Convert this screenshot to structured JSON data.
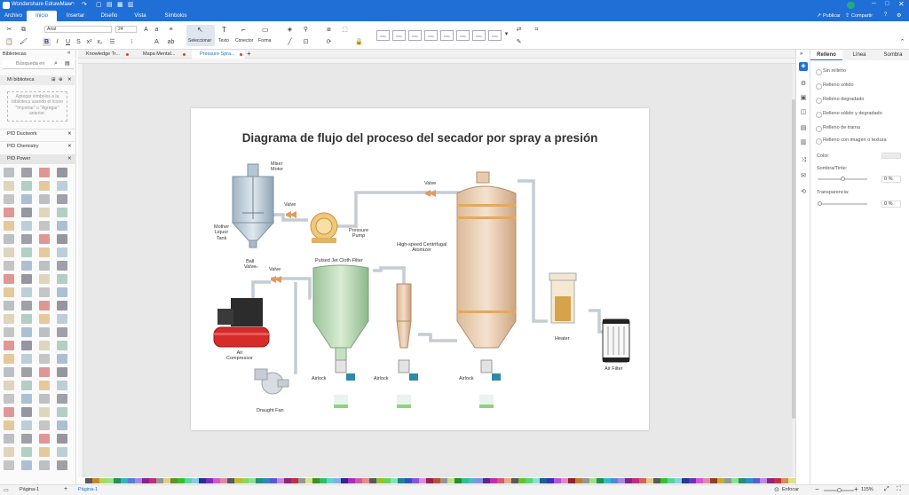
{
  "titlebar": {
    "app_name": "Wondershare EdrawMax",
    "publish": "Publicar",
    "share": "Compartir"
  },
  "menu": {
    "tabs": [
      "Archivo",
      "Inicio",
      "Insertar",
      "Diseño",
      "Vista",
      "Símbolos"
    ],
    "active": "Inicio"
  },
  "ribbon": {
    "font_family": "Arial",
    "font_size": "24",
    "tools": [
      "Seleccionar",
      "Texto",
      "Conector",
      "Forma"
    ],
    "style_swatch_label": "Abc"
  },
  "document_tabs": [
    {
      "label": "Knowledge Tr...",
      "dot": true
    },
    {
      "label": "Mapa Mental...",
      "dot": true
    },
    {
      "label": "Pressure Spra...",
      "dot": true,
      "active": true
    }
  ],
  "left_panel": {
    "title": "Bibliotecas",
    "search_placeholder": "Búsqueda en",
    "my_library": "Mi biblioteca",
    "my_library_hint": "Agregar símbolos a la biblioteca usando el ícono \"Importar\" o \"Agregar\" anterior.",
    "categories": [
      "PID Ductwork",
      "PID Chemistry",
      "PID Power"
    ]
  },
  "diagram": {
    "title": "Diagrama de flujo del proceso del secador por spray a presión",
    "labels": {
      "mixer_motor": "Mixer\nMotor",
      "mother_liquor_tank": "Mother\nLiquor\nTank",
      "ball_valve": "Ball\nValve",
      "valve_1": "Valve",
      "valve_2": "Valve",
      "valve_3": "Valve",
      "pressure_pump": "Pressure\nPump",
      "atomizer": "High-speed Centrifugal\nAtomizer",
      "pulsed_filter": "Pulsed Jet Cloth Filter",
      "air_compressor": "Air\nCompressor",
      "draught_fan": "Draught Fan",
      "airlock_1": "Airlock",
      "airlock_2": "Airlock",
      "airlock_3": "Airlock",
      "heater": "Heater",
      "air_filter": "Air Filter"
    }
  },
  "right_panel": {
    "tabs": [
      "Relleno",
      "Línea",
      "Sombra"
    ],
    "active_tab": "Relleno",
    "fill_options": [
      "Sin relleno",
      "Relleno sólido",
      "Relleno degradado",
      "Relleno sólido y degradado",
      "Relleno de trama",
      "Relleno con imagen o textura"
    ],
    "color_label": "Color:",
    "shade_label": "Sombra/Tinte:",
    "shade_value": "0 %",
    "transparency_label": "Transparencia:",
    "transparency_value": "0 %"
  },
  "statusbar": {
    "page_selector": "Página-1",
    "page_tab": "Página-1",
    "focus": "Enfocar",
    "zoom": "115%"
  },
  "colors": {
    "accent": "#1f6fd6",
    "canvas": "#e8e8e8"
  }
}
